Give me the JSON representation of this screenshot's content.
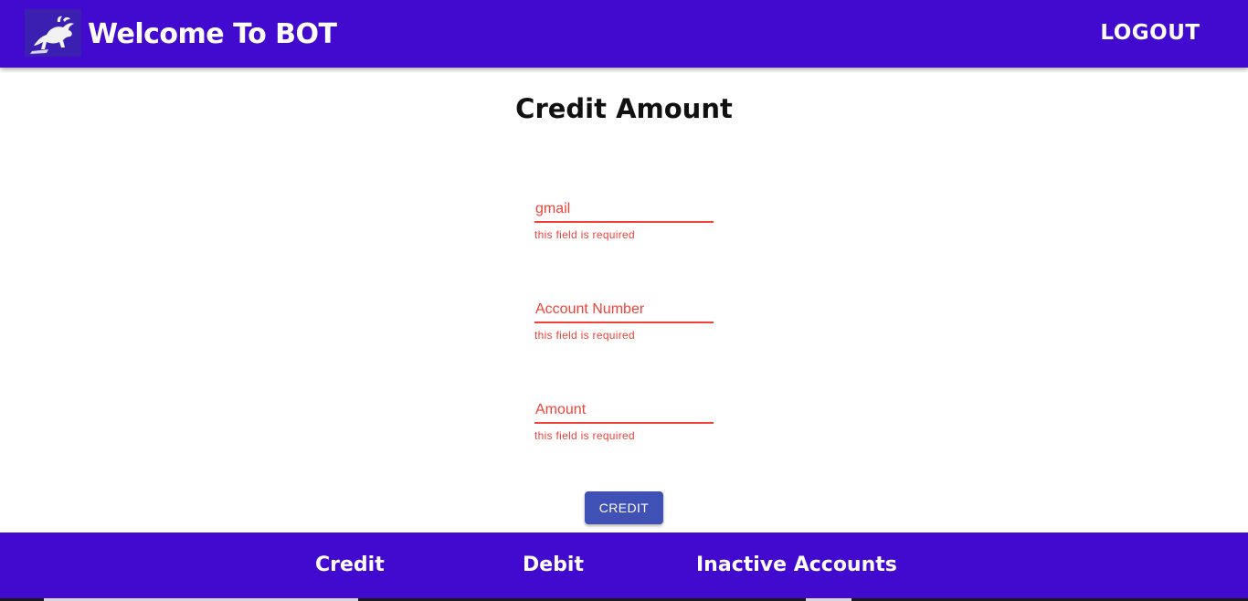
{
  "header": {
    "title": "Welcome To BOT",
    "logout_label": "LOGOUT",
    "logo_icon": "bull-logo-icon"
  },
  "page": {
    "heading": "Credit Amount"
  },
  "form": {
    "fields": [
      {
        "placeholder": "gmail",
        "value": "",
        "error": "this field is required"
      },
      {
        "placeholder": "Account Number",
        "value": "",
        "error": "this field is required"
      },
      {
        "placeholder": "Amount",
        "value": "",
        "error": "this field is required"
      }
    ],
    "submit_label": "CREDIT"
  },
  "footer": {
    "links": [
      {
        "label": "Credit"
      },
      {
        "label": "Debit"
      },
      {
        "label": "Inactive Accounts"
      }
    ]
  },
  "colors": {
    "primary": "#4209cf",
    "button": "#3f51b5",
    "error": "#f04238"
  }
}
